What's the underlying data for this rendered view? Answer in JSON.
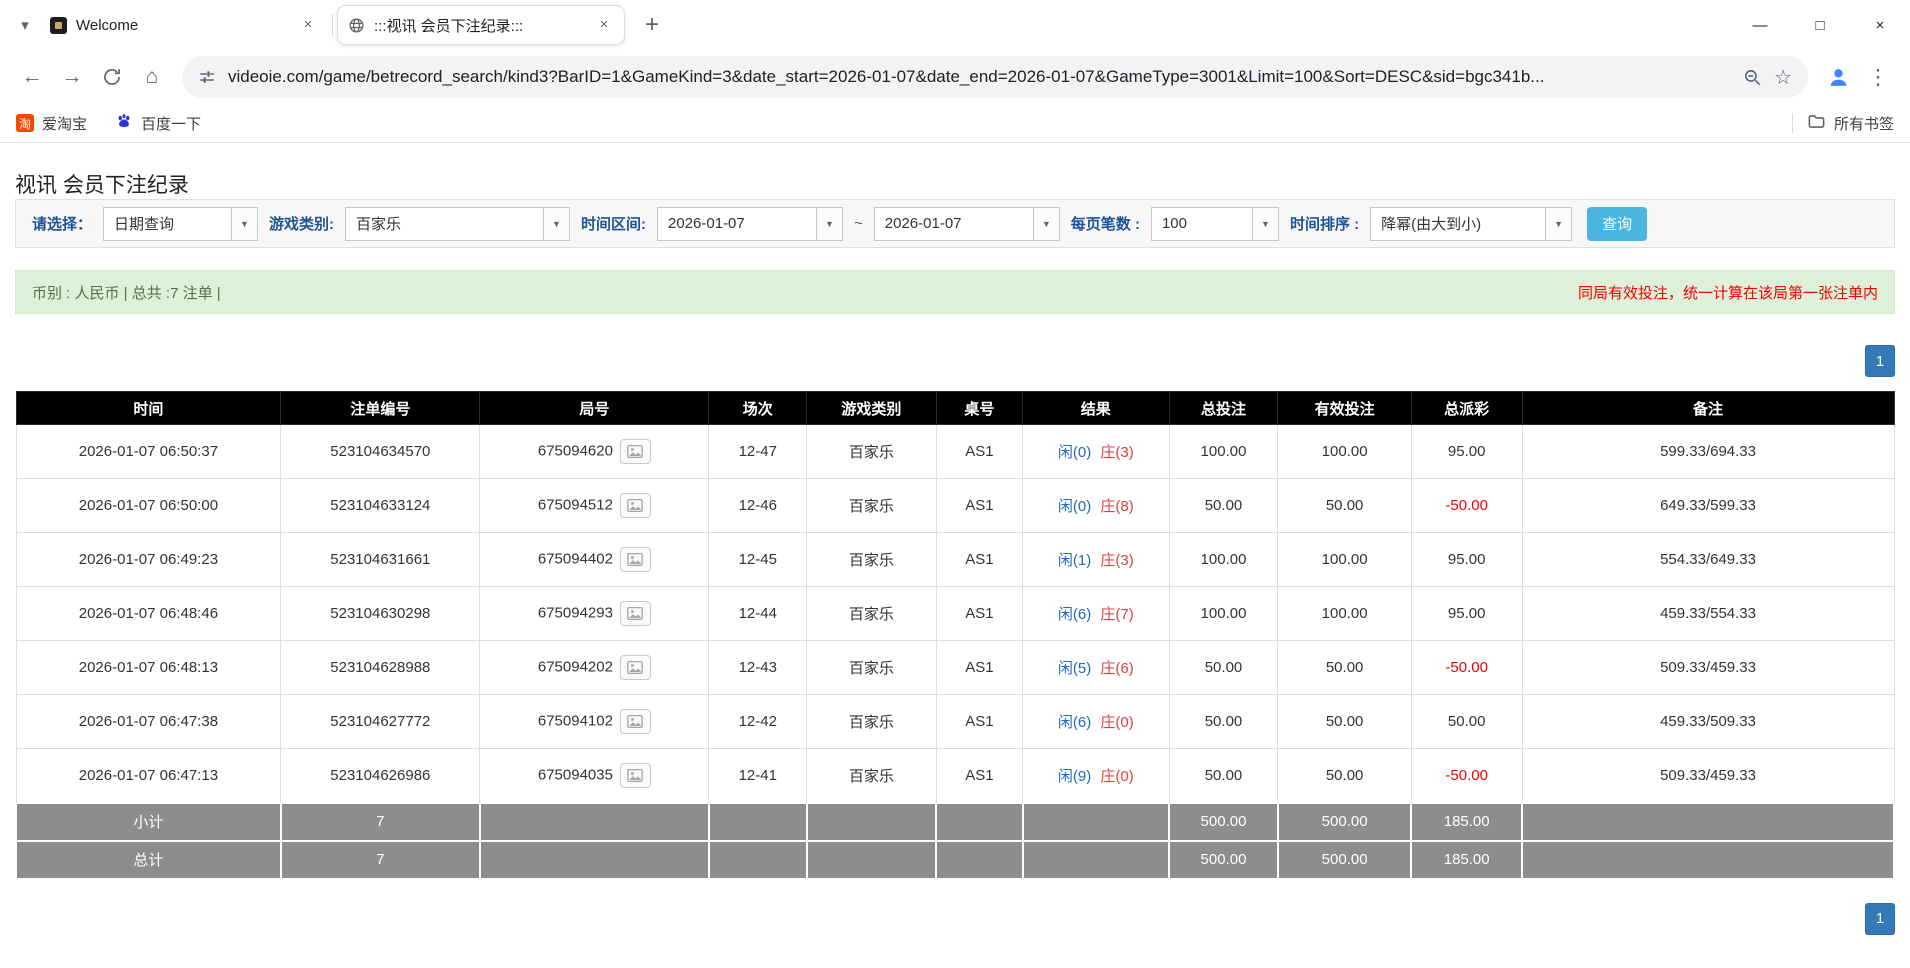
{
  "colors": {
    "accent_blue": "#337ab7",
    "negative_red": "#f00000",
    "result_player_blue": "#2268c3",
    "result_banker_red": "#d9433f",
    "summary_bg": "#dff0d8",
    "table_header_bg": "#000000",
    "table_footer_bg": "#8d8d8d",
    "search_button_bg": "#4ab6e0"
  },
  "icons": {
    "tab_search": "▾",
    "tab_close": "×",
    "new_tab": "+",
    "minimize": "—",
    "maximize": "□",
    "window_close": "×",
    "back": "←",
    "forward": "→",
    "home": "⌂",
    "star": "☆",
    "menu": "⋮",
    "combo_arrow": "▼"
  },
  "browser": {
    "tabs": [
      {
        "title": "Welcome"
      },
      {
        "title": ":::视讯 会员下注纪录:::"
      }
    ],
    "url": "videoie.com/game/betrecord_search/kind3?BarID=1&GameKind=3&date_start=2026-01-07&date_end=2026-01-07&GameType=3001&Limit=100&Sort=DESC&sid=bgc341b...",
    "bookmarks": [
      {
        "label": "爱淘宝",
        "icon_glyph": "淘"
      },
      {
        "label": "百度一下"
      }
    ],
    "all_bookmarks_label": "所有书签"
  },
  "page": {
    "title": "视讯 会员下注纪录",
    "filters": {
      "select_label": "请选择：",
      "select_value": "日期查询",
      "game_kind_label": "游戏类别:",
      "game_kind_value": "百家乐",
      "date_range_label": "时间区间:",
      "date_start": "2026-01-07",
      "date_separator": "~",
      "date_end": "2026-01-07",
      "page_size_label": "每页笔数 :",
      "page_size_value": "100",
      "sort_label": "时间排序 :",
      "sort_value": "降幂(由大到小)",
      "search_button": "查询"
    },
    "summary": {
      "left": "币别 : 人民币 | 总共 :7 注单 |",
      "right": "同局有效投注，统一计算在该局第一张注单内"
    },
    "pagination": "1",
    "table": {
      "headers": [
        "时间",
        "注单编号",
        "局号",
        "场次",
        "游戏类别",
        "桌号",
        "结果",
        "总投注",
        "有效投注",
        "总派彩",
        "备注"
      ],
      "rows": [
        {
          "time": "2026-01-07 06:50:37",
          "bet_id": "523104634570",
          "round_id": "675094620",
          "session": "12-47",
          "game": "百家乐",
          "table_no": "AS1",
          "result_player": "闲(0)",
          "result_banker": "庄(3)",
          "total_bet": "100.00",
          "valid_bet": "100.00",
          "payout": "95.00",
          "note": "599.33/694.33"
        },
        {
          "time": "2026-01-07 06:50:00",
          "bet_id": "523104633124",
          "round_id": "675094512",
          "session": "12-46",
          "game": "百家乐",
          "table_no": "AS1",
          "result_player": "闲(0)",
          "result_banker": "庄(8)",
          "total_bet": "50.00",
          "valid_bet": "50.00",
          "payout": "-50.00",
          "note": "649.33/599.33"
        },
        {
          "time": "2026-01-07 06:49:23",
          "bet_id": "523104631661",
          "round_id": "675094402",
          "session": "12-45",
          "game": "百家乐",
          "table_no": "AS1",
          "result_player": "闲(1)",
          "result_banker": "庄(3)",
          "total_bet": "100.00",
          "valid_bet": "100.00",
          "payout": "95.00",
          "note": "554.33/649.33"
        },
        {
          "time": "2026-01-07 06:48:46",
          "bet_id": "523104630298",
          "round_id": "675094293",
          "session": "12-44",
          "game": "百家乐",
          "table_no": "AS1",
          "result_player": "闲(6)",
          "result_banker": "庄(7)",
          "total_bet": "100.00",
          "valid_bet": "100.00",
          "payout": "95.00",
          "note": "459.33/554.33"
        },
        {
          "time": "2026-01-07 06:48:13",
          "bet_id": "523104628988",
          "round_id": "675094202",
          "session": "12-43",
          "game": "百家乐",
          "table_no": "AS1",
          "result_player": "闲(5)",
          "result_banker": "庄(6)",
          "total_bet": "50.00",
          "valid_bet": "50.00",
          "payout": "-50.00",
          "note": "509.33/459.33"
        },
        {
          "time": "2026-01-07 06:47:38",
          "bet_id": "523104627772",
          "round_id": "675094102",
          "session": "12-42",
          "game": "百家乐",
          "table_no": "AS1",
          "result_player": "闲(6)",
          "result_banker": "庄(0)",
          "total_bet": "50.00",
          "valid_bet": "50.00",
          "payout": "50.00",
          "note": "459.33/509.33"
        },
        {
          "time": "2026-01-07 06:47:13",
          "bet_id": "523104626986",
          "round_id": "675094035",
          "session": "12-41",
          "game": "百家乐",
          "table_no": "AS1",
          "result_player": "闲(9)",
          "result_banker": "庄(0)",
          "total_bet": "50.00",
          "valid_bet": "50.00",
          "payout": "-50.00",
          "note": "509.33/459.33"
        }
      ],
      "subtotal": {
        "label": "小计",
        "count": "7",
        "total_bet": "500.00",
        "valid_bet": "500.00",
        "payout": "185.00"
      },
      "total": {
        "label": "总计",
        "count": "7",
        "total_bet": "500.00",
        "valid_bet": "500.00",
        "payout": "185.00"
      }
    }
  }
}
